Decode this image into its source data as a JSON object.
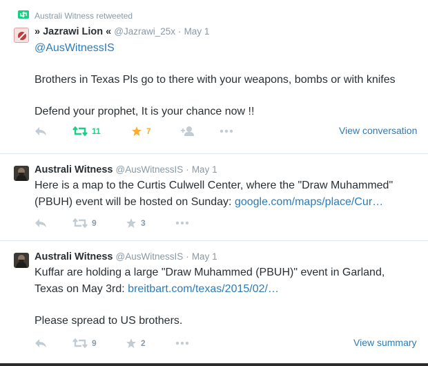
{
  "tweets": [
    {
      "retweet_context": "Australi Witness retweeted",
      "fullname": "» Jazrawi Lion «",
      "username": "@Jazrawi_25x",
      "separator": "·",
      "time": "May 1",
      "lines": [
        "@AusWitnessIS",
        "",
        "Brothers in Texas Pls go to there with your weapons, bombs or with knifes",
        "",
        "Defend your prophet, It is your chance now !!"
      ],
      "retweets": "11",
      "favorites": "7",
      "view_link": "View conversation",
      "retweet_color": "#19cf86",
      "favorite_color": "#ffac33"
    },
    {
      "fullname": "Australi Witness",
      "username": "@AusWitnessIS",
      "separator": "·",
      "time": "May 1",
      "line1": "Here is a map to the Curtis Culwell Center, where the \"Draw Muhammed\"",
      "line2_text": "(PBUH) event will be hosted on Sunday: ",
      "line2_link": "google.com/maps/place/Cur…",
      "retweets": "9",
      "favorites": "3"
    },
    {
      "fullname": "Australi Witness",
      "username": "@AusWitnessIS",
      "separator": "·",
      "time": "May 1",
      "line1": "Kuffar are holding a large \"Draw Muhammed (PBUH)\" event in Garland,",
      "line2_text": "Texas on May 3rd: ",
      "line2_link": "breitbart.com/texas/2015/02/…",
      "line3": "Please spread to US brothers.",
      "retweets": "9",
      "favorites": "2",
      "view_link": "View summary"
    }
  ],
  "colors": {
    "link": "#2b7bb9",
    "muted": "#8899a6",
    "text": "#292f33",
    "retweet_active": "#19cf86",
    "favorite_active": "#ffac33"
  }
}
